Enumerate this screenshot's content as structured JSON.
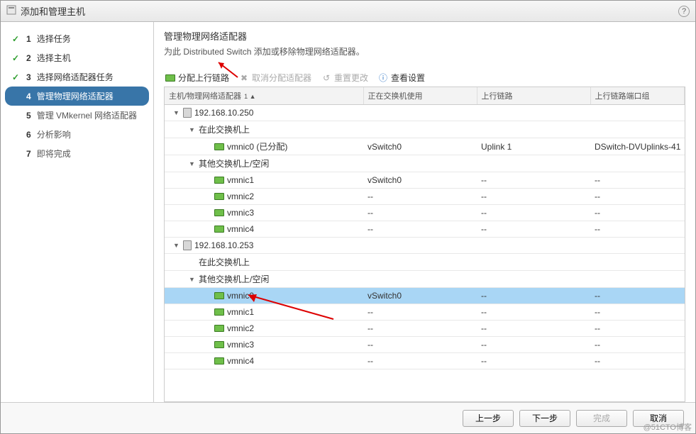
{
  "window": {
    "title": "添加和管理主机",
    "help": "?"
  },
  "sidebar": {
    "steps": [
      {
        "num": "1",
        "label": "选择任务",
        "state": "completed"
      },
      {
        "num": "2",
        "label": "选择主机",
        "state": "completed"
      },
      {
        "num": "3",
        "label": "选择网络适配器任务",
        "state": "completed"
      },
      {
        "num": "4",
        "label": "管理物理网络适配器",
        "state": "active"
      },
      {
        "num": "5",
        "label": "管理 VMkernel 网络适配器",
        "state": "future"
      },
      {
        "num": "6",
        "label": "分析影响",
        "state": "future"
      },
      {
        "num": "7",
        "label": "即将完成",
        "state": "future"
      }
    ]
  },
  "main": {
    "heading": "管理物理网络适配器",
    "subheading": "为此 Distributed Switch 添加或移除物理网络适配器。",
    "toolbar": {
      "assign": "分配上行链路",
      "unassign": "取消分配适配器",
      "reset": "重置更改",
      "view": "查看设置"
    },
    "columns": {
      "c1": "主机/物理网络适配器",
      "c1sort": "1 ▲",
      "c2": "正在交换机使用",
      "c3": "上行链路",
      "c4": "上行链路端口组"
    },
    "rows": [
      {
        "type": "host",
        "indent": 0,
        "twisty": "▼",
        "icon": "host",
        "label": "192.168.10.250",
        "c2": "",
        "c3": "",
        "c4": ""
      },
      {
        "type": "group",
        "indent": 1,
        "twisty": "▼",
        "label": "在此交换机上",
        "c2": "",
        "c3": "",
        "c4": ""
      },
      {
        "type": "nic",
        "indent": 2,
        "icon": "nic",
        "label": "vmnic0 (已分配)",
        "c2": "vSwitch0",
        "c3": "Uplink 1",
        "c4": "DSwitch-DVUplinks-41"
      },
      {
        "type": "group",
        "indent": 1,
        "twisty": "▼",
        "label": "其他交换机上/空闲",
        "c2": "",
        "c3": "",
        "c4": ""
      },
      {
        "type": "nic",
        "indent": 2,
        "icon": "nic",
        "label": "vmnic1",
        "c2": "vSwitch0",
        "c3": "--",
        "c4": "--"
      },
      {
        "type": "nic",
        "indent": 2,
        "icon": "nic",
        "label": "vmnic2",
        "c2": "--",
        "c3": "--",
        "c4": "--"
      },
      {
        "type": "nic",
        "indent": 2,
        "icon": "nic",
        "label": "vmnic3",
        "c2": "--",
        "c3": "--",
        "c4": "--"
      },
      {
        "type": "nic",
        "indent": 2,
        "icon": "nic",
        "label": "vmnic4",
        "c2": "--",
        "c3": "--",
        "c4": "--"
      },
      {
        "type": "host",
        "indent": 0,
        "twisty": "▼",
        "icon": "host",
        "label": "192.168.10.253",
        "c2": "",
        "c3": "",
        "c4": ""
      },
      {
        "type": "group",
        "indent": 1,
        "twisty": "",
        "label": "在此交换机上",
        "c2": "",
        "c3": "",
        "c4": ""
      },
      {
        "type": "group",
        "indent": 1,
        "twisty": "▼",
        "label": "其他交换机上/空闲",
        "c2": "",
        "c3": "",
        "c4": ""
      },
      {
        "type": "nic",
        "indent": 2,
        "icon": "nic",
        "label": "vmnic0",
        "selected": true,
        "c2": "vSwitch0",
        "c3": "--",
        "c4": "--"
      },
      {
        "type": "nic",
        "indent": 2,
        "icon": "nic",
        "label": "vmnic1",
        "c2": "--",
        "c3": "--",
        "c4": "--"
      },
      {
        "type": "nic",
        "indent": 2,
        "icon": "nic",
        "label": "vmnic2",
        "c2": "--",
        "c3": "--",
        "c4": "--"
      },
      {
        "type": "nic",
        "indent": 2,
        "icon": "nic",
        "label": "vmnic3",
        "c2": "--",
        "c3": "--",
        "c4": "--"
      },
      {
        "type": "nic",
        "indent": 2,
        "icon": "nic",
        "label": "vmnic4",
        "c2": "--",
        "c3": "--",
        "c4": "--"
      }
    ]
  },
  "footer": {
    "back": "上一步",
    "next": "下一步",
    "finish": "完成",
    "cancel": "取消"
  },
  "watermark": "@51CTO博客"
}
